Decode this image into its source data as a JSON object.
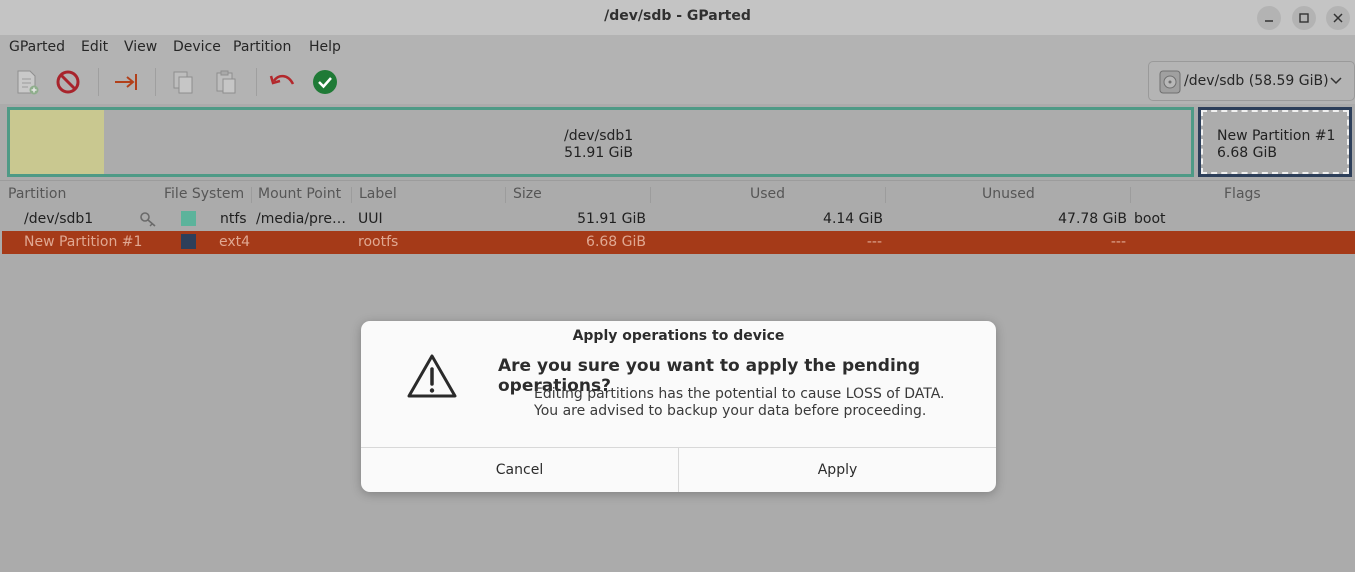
{
  "window": {
    "title": "/dev/sdb - GParted"
  },
  "menu": [
    "GParted",
    "Edit",
    "View",
    "Device",
    "Partition",
    "Help"
  ],
  "toolbar": {
    "icons": [
      "new-partition-icon",
      "delete-icon",
      "resize-move-icon",
      "copy-icon",
      "paste-icon",
      "undo-icon",
      "apply-icon"
    ],
    "device_selector": "/dev/sdb (58.59 GiB)"
  },
  "disk_map": {
    "partitions": [
      {
        "name": "/dev/sdb1",
        "size": "51.91 GiB",
        "color": "#4e9a86"
      },
      {
        "name": "New Partition #1",
        "size": "6.68 GiB",
        "color": "#2d3f5a"
      }
    ]
  },
  "table": {
    "columns": [
      "Partition",
      "File System",
      "Mount Point",
      "Label",
      "Size",
      "Used",
      "Unused",
      "Flags"
    ],
    "rows": [
      {
        "partition": "/dev/sdb1",
        "filesystem": "ntfs",
        "fs_color": "#5cb39b",
        "mount": "/media/pre…",
        "label": "UUI",
        "size": "51.91 GiB",
        "used": "4.14 GiB",
        "unused": "47.78 GiB",
        "flags": "boot",
        "locked": true
      },
      {
        "partition": "New Partition #1",
        "filesystem": "ext4",
        "fs_color": "#2d3f5a",
        "mount": "",
        "label": "rootfs",
        "size": "6.68 GiB",
        "used": "---",
        "unused": "---",
        "flags": "",
        "selected": true
      }
    ]
  },
  "dialog": {
    "title": "Apply operations to device",
    "primary": "Are you sure you want to apply the pending operations?",
    "secondary_line1": "Editing partitions has the potential to cause LOSS of DATA.",
    "secondary_line2": "You are advised to backup your data before proceeding.",
    "cancel_label": "Cancel",
    "apply_label": "Apply"
  }
}
